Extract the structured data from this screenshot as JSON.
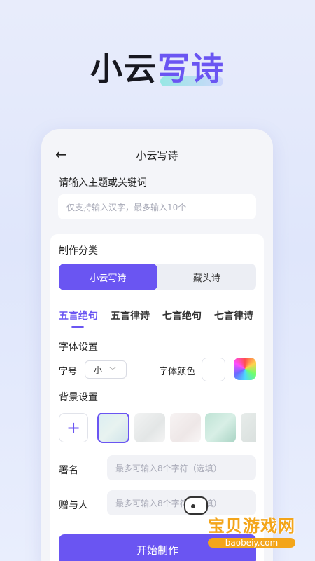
{
  "hero": {
    "part1": "小云",
    "part2": "写诗"
  },
  "header": {
    "back_glyph": "←",
    "title": "小云写诗"
  },
  "topic": {
    "label": "请输入主题或关键词",
    "placeholder": "仅支持输入汉字，最多输入10个"
  },
  "category": {
    "label": "制作分类",
    "options": [
      "小云写诗",
      "藏头诗"
    ],
    "selected": "小云写诗"
  },
  "poem_types": {
    "items": [
      "五言绝句",
      "五言律诗",
      "七言绝句",
      "七言律诗"
    ],
    "selected": "五言绝句"
  },
  "font_settings": {
    "label": "字体设置",
    "size_label": "字号",
    "size_value": "小",
    "color_label": "字体颜色",
    "color_selected": "#ffffff"
  },
  "background": {
    "label": "背景设置",
    "add_glyph": "+",
    "selected_index": 0
  },
  "signature": {
    "label": "署名",
    "placeholder": "最多可输入8个字符（选填）"
  },
  "recipient": {
    "label": "赠与人",
    "placeholder": "最多可输入8个字符（选填）"
  },
  "start_button": "开始制作",
  "watermark": {
    "title": "宝贝游戏网",
    "url": "baobeiy.com"
  },
  "colors": {
    "accent": "#6a55f2",
    "watermark": "#f3a51a"
  }
}
